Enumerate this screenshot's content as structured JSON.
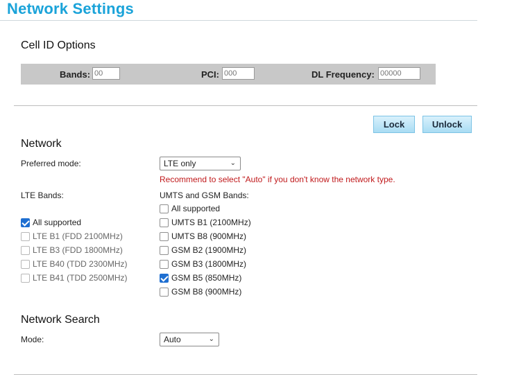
{
  "page": {
    "title": "Network Settings"
  },
  "cell_id": {
    "title": "Cell ID Options",
    "bands_label": "Bands:",
    "bands_placeholder": "00",
    "pci_label": "PCI:",
    "pci_placeholder": "000",
    "dl_label": "DL Frequency:",
    "dl_placeholder": "00000"
  },
  "buttons": {
    "lock": "Lock",
    "unlock": "Unlock"
  },
  "network": {
    "title": "Network",
    "preferred_mode_label": "Preferred mode:",
    "preferred_mode_value": "LTE only",
    "recommend_text": "Recommend to select \"Auto\" if you don't know the network type.",
    "lte_bands_label": "LTE Bands:",
    "umts_gsm_label": "UMTS and GSM Bands:",
    "lte_bands": [
      {
        "label": "All supported",
        "checked": true
      },
      {
        "label": "LTE B1 (FDD 2100MHz)",
        "checked": false
      },
      {
        "label": "LTE B3 (FDD 1800MHz)",
        "checked": false
      },
      {
        "label": "LTE B40 (TDD 2300MHz)",
        "checked": false
      },
      {
        "label": "LTE B41 (TDD 2500MHz)",
        "checked": false
      }
    ],
    "umts_gsm_bands": [
      {
        "label": "All supported",
        "checked": false
      },
      {
        "label": "UMTS B1 (2100MHz)",
        "checked": false
      },
      {
        "label": "UMTS B8 (900MHz)",
        "checked": false
      },
      {
        "label": "GSM B2 (1900MHz)",
        "checked": false
      },
      {
        "label": "GSM B3 (1800MHz)",
        "checked": false
      },
      {
        "label": "GSM B5 (850MHz)",
        "checked": true
      },
      {
        "label": "GSM B8 (900MHz)",
        "checked": false
      }
    ]
  },
  "network_search": {
    "title": "Network Search",
    "mode_label": "Mode:",
    "mode_value": "Auto"
  },
  "colors": {
    "title": "#1aa3d9",
    "warning": "#c0191b",
    "checkbox": "#1f6fd1"
  }
}
